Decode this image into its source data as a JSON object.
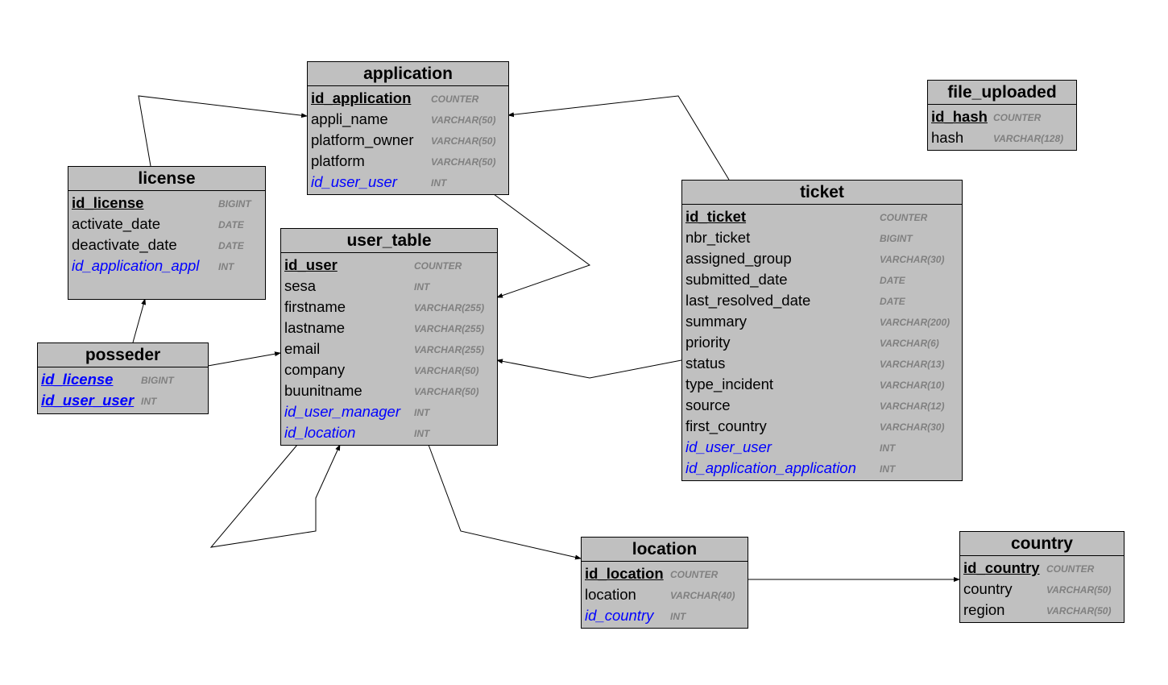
{
  "colors": {
    "table_bg": "#c0c0c0",
    "foreign_key": "#0000ff",
    "type_text": "#808080",
    "border": "#000000"
  },
  "tables": [
    {
      "name": "application",
      "fields": [
        {
          "name": "id_application",
          "type": "COUNTER",
          "key": "pk"
        },
        {
          "name": "appli_name",
          "type": "VARCHAR(50)",
          "key": ""
        },
        {
          "name": "platform_owner",
          "type": "VARCHAR(50)",
          "key": ""
        },
        {
          "name": "platform",
          "type": "VARCHAR(50)",
          "key": ""
        },
        {
          "name": "id_user_user",
          "type": "INT",
          "key": "fk"
        }
      ]
    },
    {
      "name": "license",
      "fields": [
        {
          "name": "id_license",
          "type": "BIGINT",
          "key": "pk"
        },
        {
          "name": "activate_date",
          "type": "DATE",
          "key": ""
        },
        {
          "name": "deactivate_date",
          "type": "DATE",
          "key": ""
        },
        {
          "name": "id_application_appl",
          "type": "INT",
          "key": "fk"
        }
      ]
    },
    {
      "name": "user_table",
      "fields": [
        {
          "name": "id_user",
          "type": "COUNTER",
          "key": "pk"
        },
        {
          "name": "sesa",
          "type": "INT",
          "key": ""
        },
        {
          "name": "firstname",
          "type": "VARCHAR(255)",
          "key": ""
        },
        {
          "name": "lastname",
          "type": "VARCHAR(255)",
          "key": ""
        },
        {
          "name": "email",
          "type": "VARCHAR(255)",
          "key": ""
        },
        {
          "name": "company",
          "type": "VARCHAR(50)",
          "key": ""
        },
        {
          "name": "buunitname",
          "type": "VARCHAR(50)",
          "key": ""
        },
        {
          "name": "id_user_manager",
          "type": "INT",
          "key": "fk"
        },
        {
          "name": "id_location",
          "type": "INT",
          "key": "fk"
        }
      ]
    },
    {
      "name": "posseder",
      "fields": [
        {
          "name": "id_license",
          "type": "BIGINT",
          "key": "pkfk"
        },
        {
          "name": "id_user_user",
          "type": "INT",
          "key": "pkfk"
        }
      ]
    },
    {
      "name": "ticket",
      "fields": [
        {
          "name": "id_ticket",
          "type": "COUNTER",
          "key": "pk"
        },
        {
          "name": "nbr_ticket",
          "type": "BIGINT",
          "key": ""
        },
        {
          "name": "assigned_group",
          "type": "VARCHAR(30)",
          "key": ""
        },
        {
          "name": "submitted_date",
          "type": "DATE",
          "key": ""
        },
        {
          "name": "last_resolved_date",
          "type": "DATE",
          "key": ""
        },
        {
          "name": "summary",
          "type": "VARCHAR(200)",
          "key": ""
        },
        {
          "name": "priority",
          "type": "VARCHAR(6)",
          "key": ""
        },
        {
          "name": "status",
          "type": "VARCHAR(13)",
          "key": ""
        },
        {
          "name": "type_incident",
          "type": "VARCHAR(10)",
          "key": ""
        },
        {
          "name": "source",
          "type": "VARCHAR(12)",
          "key": ""
        },
        {
          "name": "first_country",
          "type": "VARCHAR(30)",
          "key": ""
        },
        {
          "name": "id_user_user",
          "type": "INT",
          "key": "fk"
        },
        {
          "name": "id_application_application",
          "type": "INT",
          "key": "fk"
        }
      ]
    },
    {
      "name": "file_uploaded",
      "fields": [
        {
          "name": "id_hash",
          "type": "COUNTER",
          "key": "pk"
        },
        {
          "name": "hash",
          "type": "VARCHAR(128)",
          "key": ""
        }
      ]
    },
    {
      "name": "location",
      "fields": [
        {
          "name": "id_location",
          "type": "COUNTER",
          "key": "pk"
        },
        {
          "name": "location",
          "type": "VARCHAR(40)",
          "key": ""
        },
        {
          "name": "id_country",
          "type": "INT",
          "key": "fk"
        }
      ]
    },
    {
      "name": "country",
      "fields": [
        {
          "name": "id_country",
          "type": "COUNTER",
          "key": "pk"
        },
        {
          "name": "country",
          "type": "VARCHAR(50)",
          "key": ""
        },
        {
          "name": "region",
          "type": "VARCHAR(50)",
          "key": ""
        }
      ]
    }
  ],
  "relationships": [
    {
      "from": "license",
      "to": "application"
    },
    {
      "from": "ticket",
      "to": "application"
    },
    {
      "from": "application",
      "to": "user_table"
    },
    {
      "from": "ticket",
      "to": "user_table"
    },
    {
      "from": "posseder",
      "to": "user_table"
    },
    {
      "from": "posseder",
      "to": "license"
    },
    {
      "from": "user_table",
      "to": "user_table"
    },
    {
      "from": "user_table",
      "to": "location"
    },
    {
      "from": "location",
      "to": "country"
    }
  ]
}
